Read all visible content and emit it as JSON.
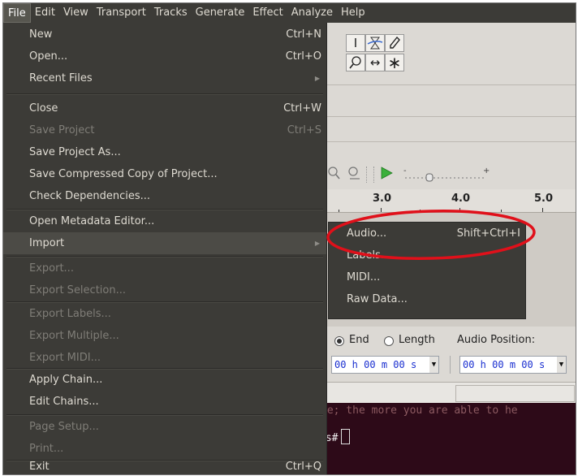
{
  "menubar": {
    "items": [
      "File",
      "Edit",
      "View",
      "Transport",
      "Tracks",
      "Generate",
      "Effect",
      "Analyze",
      "Help"
    ]
  },
  "file_menu": {
    "items": [
      {
        "label": "New",
        "shortcut": "Ctrl+N",
        "enabled": true
      },
      {
        "label": "Open...",
        "shortcut": "Ctrl+O",
        "enabled": true
      },
      {
        "label": "Recent Files",
        "shortcut": "",
        "enabled": true,
        "submenu": true
      },
      {
        "label": "Close",
        "shortcut": "Ctrl+W",
        "enabled": true
      },
      {
        "label": "Save Project",
        "shortcut": "Ctrl+S",
        "enabled": false
      },
      {
        "label": "Save Project As...",
        "shortcut": "",
        "enabled": true
      },
      {
        "label": "Save Compressed Copy of Project...",
        "shortcut": "",
        "enabled": true
      },
      {
        "label": "Check Dependencies...",
        "shortcut": "",
        "enabled": true
      },
      {
        "label": "Open Metadata Editor...",
        "shortcut": "",
        "enabled": true
      },
      {
        "label": "Import",
        "shortcut": "",
        "enabled": true,
        "submenu": true,
        "highlighted": true
      },
      {
        "label": "Export...",
        "shortcut": "",
        "enabled": false
      },
      {
        "label": "Export Selection...",
        "shortcut": "",
        "enabled": false
      },
      {
        "label": "Export Labels...",
        "shortcut": "",
        "enabled": false
      },
      {
        "label": "Export Multiple...",
        "shortcut": "",
        "enabled": false
      },
      {
        "label": "Export MIDI...",
        "shortcut": "",
        "enabled": false
      },
      {
        "label": "Apply Chain...",
        "shortcut": "",
        "enabled": true
      },
      {
        "label": "Edit Chains...",
        "shortcut": "",
        "enabled": true
      },
      {
        "label": "Page Setup...",
        "shortcut": "",
        "enabled": false
      },
      {
        "label": "Print...",
        "shortcut": "",
        "enabled": false
      },
      {
        "label": "Exit",
        "shortcut": "Ctrl+Q",
        "enabled": true
      }
    ]
  },
  "import_submenu": {
    "items": [
      {
        "label": "Audio...",
        "shortcut": "Shift+Ctrl+I"
      },
      {
        "label": "Labels...",
        "shortcut": ""
      },
      {
        "label": "MIDI...",
        "shortcut": ""
      },
      {
        "label": "Raw Data...",
        "shortcut": ""
      }
    ]
  },
  "toolbar": {
    "tools": [
      "selection-tool-icon",
      "envelope-tool-icon",
      "draw-tool-icon",
      "zoom-tool-icon",
      "timeshift-tool-icon",
      "multi-tool-icon"
    ]
  },
  "ruler": {
    "labels": [
      "3.0",
      "4.0",
      "5.0"
    ]
  },
  "selection_bar": {
    "end_label": "End",
    "length_label": "Length",
    "audio_position_label": "Audio Position:",
    "selection_time": {
      "h": "00",
      "m": "00",
      "s": "00"
    },
    "audio_position_time": {
      "h": "00",
      "m": "00",
      "s": "00"
    }
  },
  "terminal": {
    "line1": "ge; the more you are able to he",
    "prompt": "ts#"
  },
  "colors": {
    "menu_bg": "#3c3b37",
    "menu_text": "#dfdbd2",
    "disabled_text": "#7f7d77",
    "highlight_ellipse": "#e0101a",
    "time_digits": "#1a2fd0"
  }
}
